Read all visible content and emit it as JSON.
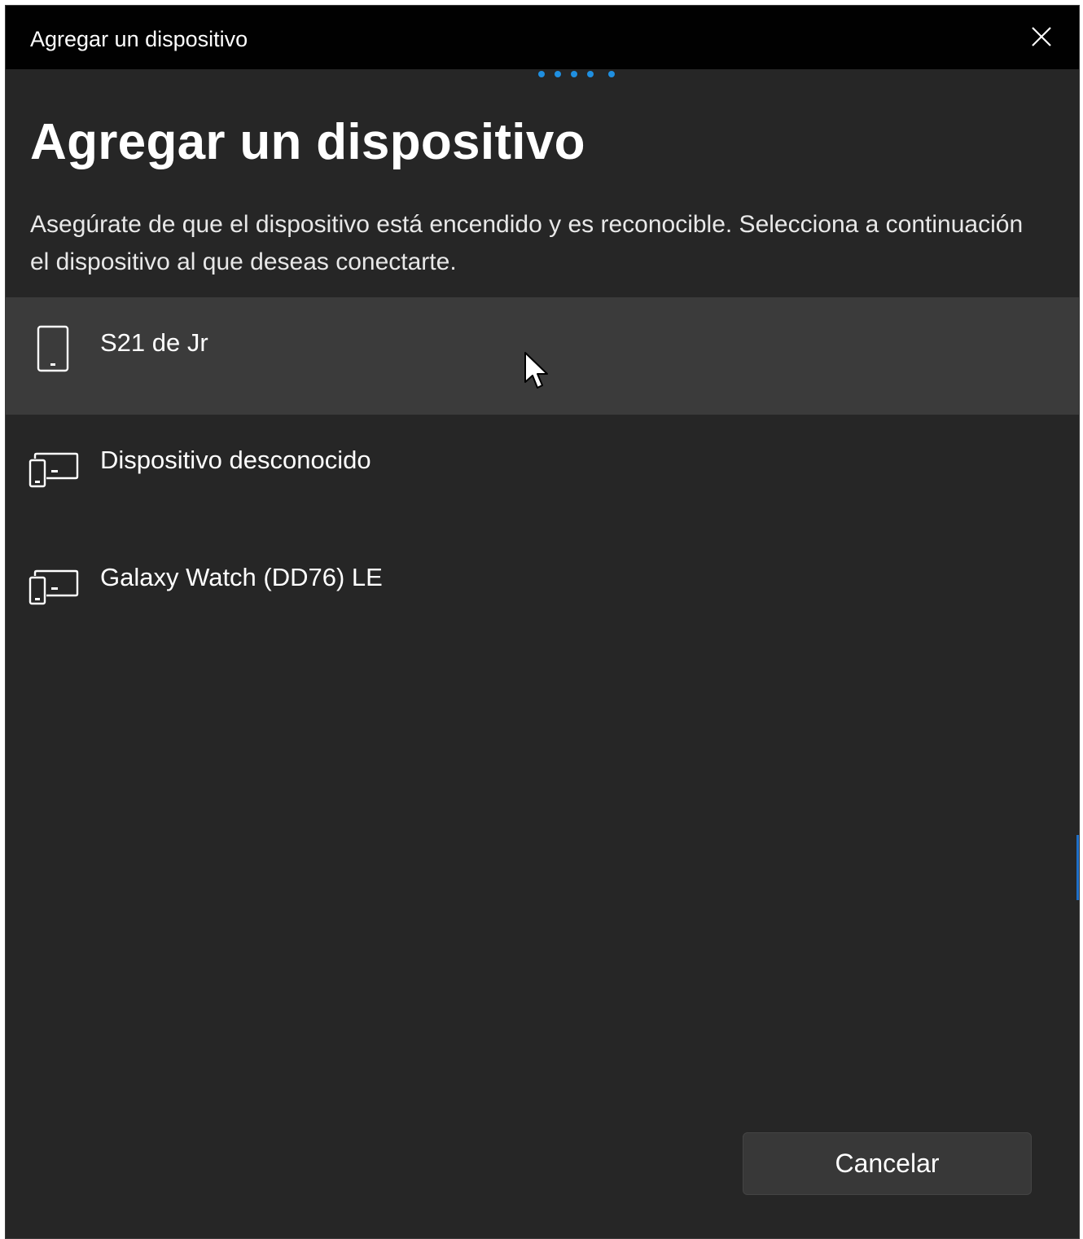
{
  "window": {
    "title": "Agregar un dispositivo"
  },
  "heading": "Agregar un dispositivo",
  "description": "Asegúrate de que el dispositivo está encendido y es reconocible. Selecciona a continuación el dispositivo al que deseas conectarte.",
  "devices": [
    {
      "name": "S21 de Jr",
      "icon": "phone-icon",
      "selected": true
    },
    {
      "name": "Dispositivo desconocido",
      "icon": "devices-icon",
      "selected": false
    },
    {
      "name": "Galaxy Watch (DD76) LE",
      "icon": "devices-icon",
      "selected": false
    }
  ],
  "buttons": {
    "cancel_label": "Cancelar"
  },
  "colors": {
    "titlebar": "#010101",
    "background": "#262626",
    "selected_row": "#3b3b3b",
    "accent": "#1f8fe0"
  }
}
